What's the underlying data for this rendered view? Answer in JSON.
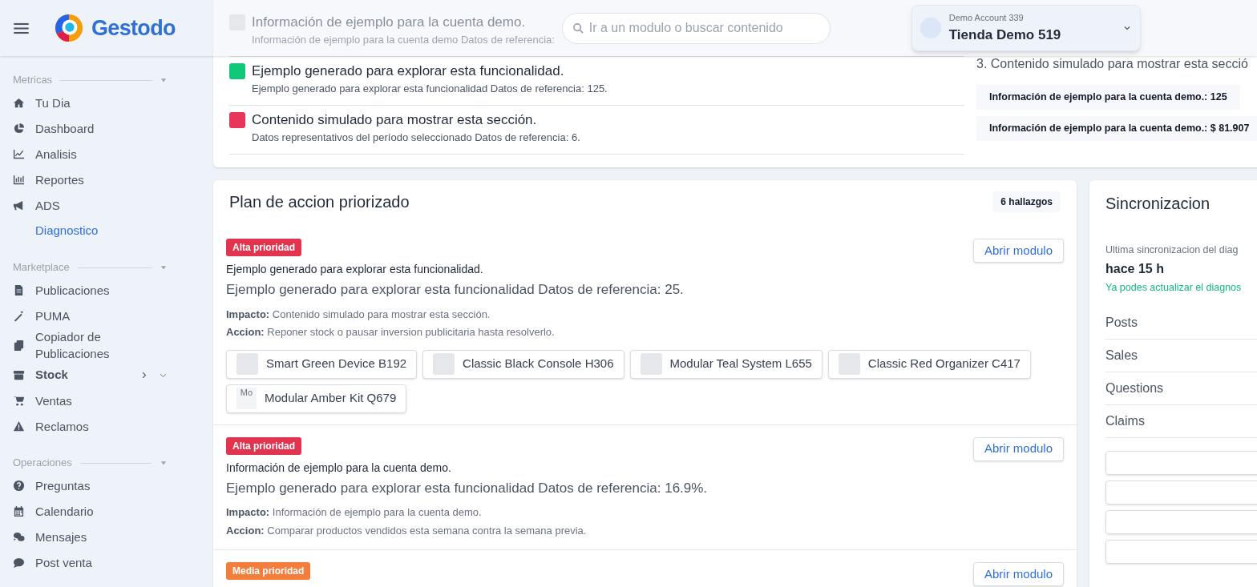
{
  "header": {
    "app_name": "Gestodo",
    "search": {
      "placeholder": "Ir a un modulo o buscar contenido"
    },
    "account": {
      "label": "Demo Account 339",
      "store": "Tienda Demo 519"
    }
  },
  "sidebar": {
    "sections": [
      {
        "title": "Metricas",
        "items": [
          {
            "label": "Tu Dia",
            "kind": "link",
            "selected": false
          },
          {
            "label": "Dashboard",
            "kind": "link",
            "selected": false
          },
          {
            "label": "Analisis",
            "kind": "link",
            "selected": false
          },
          {
            "label": "Reportes",
            "kind": "link",
            "selected": false
          },
          {
            "label": "ADS",
            "kind": "link",
            "selected": false
          },
          {
            "label": "Diagnostico",
            "kind": "sub",
            "selected": true
          }
        ]
      },
      {
        "title": "Marketplace",
        "items": [
          {
            "label": "Publicaciones",
            "kind": "link",
            "selected": false
          },
          {
            "label": "PUMA",
            "kind": "link",
            "selected": false
          },
          {
            "label": "Copiador de Publicaciones",
            "kind": "link",
            "selected": false
          },
          {
            "label": "Stock",
            "kind": "group",
            "selected": false
          },
          {
            "label": "Ventas",
            "kind": "link",
            "selected": false
          },
          {
            "label": "Reclamos",
            "kind": "link",
            "selected": false
          }
        ]
      },
      {
        "title": "Operaciones",
        "items": [
          {
            "label": "Preguntas",
            "kind": "link",
            "selected": false
          },
          {
            "label": "Calendario",
            "kind": "link",
            "selected": false
          },
          {
            "label": "Mensajes",
            "kind": "link",
            "selected": false
          },
          {
            "label": "Post venta",
            "kind": "link",
            "selected": false
          }
        ]
      }
    ]
  },
  "summary": {
    "rows": [
      {
        "title": "Información de ejemplo para la cuenta demo.",
        "detail": "Información de ejemplo para la cuenta demo Datos de referencia:",
        "color": "#e5e7eb"
      },
      {
        "title": "Ejemplo generado para explorar esta funcionalidad.",
        "detail": "Ejemplo generado para explorar esta funcionalidad Datos de referencia: 125.",
        "color": "#10c878"
      },
      {
        "title": "Contenido simulado para mostrar esta sección.",
        "detail": "Datos representativos del período seleccionado Datos de referencia: 6.",
        "color": "#e8365a"
      }
    ],
    "steps": [
      "3. Contenido simulado para mostrar esta secció"
    ],
    "stats": [
      "Información de ejemplo para la cuenta demo.: 125",
      "Información de ejemplo para la cuenta demo.: $ 81.907"
    ]
  },
  "plan": {
    "title": "Plan de accion priorizado",
    "count": "6 hallazgos",
    "findings": [
      {
        "priority": "Alta prioridad",
        "kind": "high",
        "title": "Ejemplo generado para explorar esta funcionalidad.",
        "detail": "Ejemplo generado para explorar esta funcionalidad Datos de referencia: 25.",
        "impact_label": "Impacto:",
        "impact": "Contenido simulado para mostrar esta sección.",
        "action_label": "Accion:",
        "action": "Reponer stock o pausar inversion publicitaria hasta resolverlo.",
        "button": "Abrir modulo",
        "products": [
          {
            "name": "Smart Green Device B192"
          },
          {
            "name": "Classic Black Console H306"
          },
          {
            "name": "Modular Teal System L655"
          },
          {
            "name": "Classic Red Organizer C417"
          },
          {
            "name": "Modular Amber Kit Q679",
            "image_alt": "Mo"
          }
        ]
      },
      {
        "priority": "Alta prioridad",
        "kind": "high",
        "title": "Información de ejemplo para la cuenta demo.",
        "detail": "Ejemplo generado para explorar esta funcionalidad Datos de referencia: 16.9%.",
        "impact_label": "Impacto:",
        "impact": "Información de ejemplo para la cuenta demo.",
        "action_label": "Accion:",
        "action": "Comparar productos vendidos esta semana contra la semana previa.",
        "button": "Abrir modulo"
      },
      {
        "priority": "Media prioridad",
        "kind": "medium",
        "button": "Abrir modulo"
      }
    ]
  },
  "sync": {
    "title": "Sincronizacion",
    "last_label": "Ultima sincronizacion del diag",
    "last_value": "hace 15 h",
    "hint": "Ya podes actualizar el diagnos",
    "rows": [
      "Posts",
      "Sales",
      "Questions",
      "Claims"
    ]
  }
}
